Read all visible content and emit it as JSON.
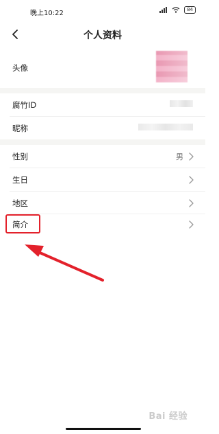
{
  "status_bar": {
    "time": "晚上10:22",
    "battery": "84"
  },
  "header": {
    "title": "个人资料"
  },
  "profile": {
    "avatar_label": "头像",
    "id_label": "腐竹ID",
    "nickname_label": "昵称",
    "gender_label": "性别",
    "gender_value": "男",
    "birthday_label": "生日",
    "region_label": "地区",
    "bio_label": "简介"
  },
  "annotation": {
    "box_color": "#e3212b",
    "arrow_color": "#e3212b"
  },
  "watermark": {
    "text": "Bai 经验"
  }
}
